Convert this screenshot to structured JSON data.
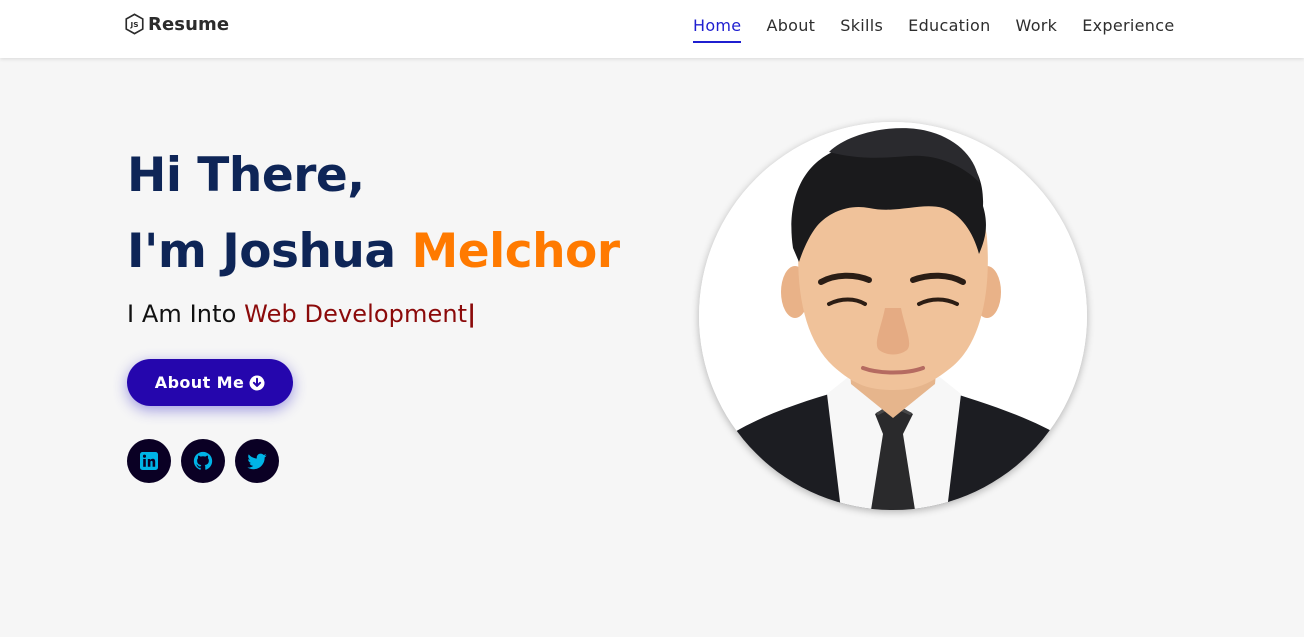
{
  "header": {
    "logo_text": "Resume",
    "logo_icon": "nodejs-hexagon-icon",
    "nav": [
      {
        "label": "Home",
        "active": true
      },
      {
        "label": "About",
        "active": false
      },
      {
        "label": "Skills",
        "active": false
      },
      {
        "label": "Education",
        "active": false
      },
      {
        "label": "Work",
        "active": false
      },
      {
        "label": "Experience",
        "active": false
      }
    ]
  },
  "hero": {
    "greeting": "Hi There,",
    "intro_prefix": "I'm Joshua",
    "intro_highlight": "Melchor",
    "typing_prefix": "I Am Into",
    "typing_value": "Web Development",
    "typing_cursor": "|",
    "button_label": "About Me",
    "button_icon": "arrow-circle-down-icon",
    "socials": [
      {
        "name": "linkedin",
        "icon": "linkedin-icon"
      },
      {
        "name": "github",
        "icon": "github-icon"
      },
      {
        "name": "twitter",
        "icon": "twitter-icon"
      }
    ],
    "photo_alt": "profile-photo"
  },
  "colors": {
    "accent_blue": "#1f1fd0",
    "heading_navy": "#0e2557",
    "highlight_orange": "#ff7a00",
    "typed_red": "#8b0a0a",
    "button_bg": "#2506ad",
    "social_bg": "#0a0024",
    "social_icon": "#00b4e6",
    "page_bg": "#f6f6f6"
  }
}
